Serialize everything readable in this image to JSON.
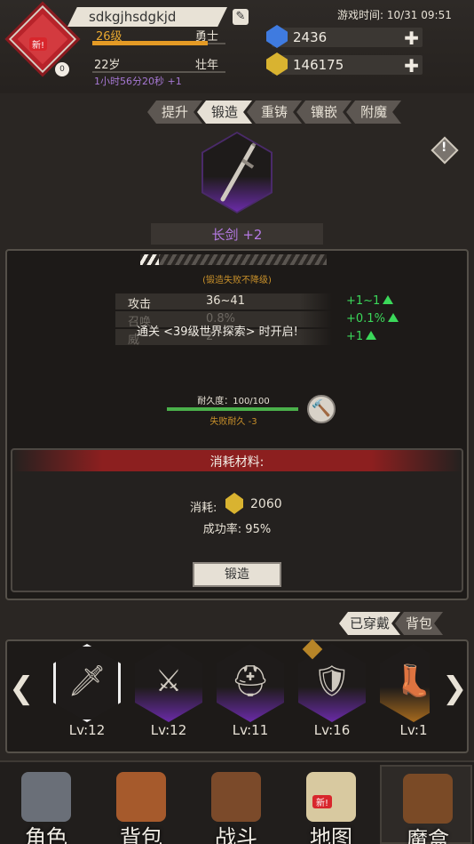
{
  "header": {
    "player_name": "sdkgjhsdgkjd",
    "new_badge": "新!",
    "level_circle": "0",
    "level": "26级",
    "class": "勇士",
    "age": "22岁",
    "life_stage": "壮年",
    "timer": "1小时56分20秒 +1",
    "game_time": "游戏时间: 10/31 09:51",
    "gems": "2436",
    "gold": "146175",
    "plus": "✚"
  },
  "tabs": [
    {
      "label": "提升"
    },
    {
      "label": "锻造"
    },
    {
      "label": "重铸"
    },
    {
      "label": "镶嵌"
    },
    {
      "label": "附魔"
    }
  ],
  "active_tab": "锻造",
  "weapon": {
    "name": "长剑 +2"
  },
  "forge": {
    "progress_fraction": 0.1,
    "fail_note": "(锻造失败不降级)",
    "stats": [
      {
        "name": "攻击",
        "value": "36~41",
        "gain": "+1~1"
      },
      {
        "name": "召唤",
        "value": "0.8%",
        "gain": "+0.1%"
      },
      {
        "name": "威",
        "value": "2",
        "gain": "+1"
      }
    ],
    "unlock_text": "通关 <39级世界探索> 时开启!",
    "durability_label": "耐久度：100/100",
    "durability_fraction": 1.0,
    "durability_loss": "失败耐久 -3",
    "materials_title": "消耗材料:",
    "cost_label": "消耗:",
    "cost_value": "2060",
    "success_rate": "成功率: 95%",
    "forge_button": "锻造"
  },
  "equip_tabs": [
    {
      "label": "已穿戴"
    },
    {
      "label": "背包"
    }
  ],
  "equipment": [
    {
      "level": "Lv:12",
      "glyph": "🗡",
      "rarity": "selected"
    },
    {
      "level": "Lv:12",
      "glyph": "⚔",
      "rarity": "purple"
    },
    {
      "level": "Lv:11",
      "glyph": "⛑",
      "rarity": "purple"
    },
    {
      "level": "Lv:16",
      "glyph": "🛡",
      "rarity": "purple"
    },
    {
      "level": "Lv:1",
      "glyph": "👢",
      "rarity": "gold"
    }
  ],
  "bottom_nav": [
    {
      "label": "角色",
      "icon": "helmet-icon"
    },
    {
      "label": "背包",
      "icon": "backpack-icon"
    },
    {
      "label": "战斗",
      "icon": "sword-shield-icon"
    },
    {
      "label": "地图",
      "icon": "scroll-map-icon"
    },
    {
      "label": "魔盒",
      "icon": "magic-box-icon"
    }
  ],
  "map_new_badge": "新!",
  "colors": {
    "accent_purple": "#b57ae4",
    "gain_green": "#3bd85a",
    "level_orange": "#e8a830",
    "materials_red": "#8c1f1f"
  }
}
